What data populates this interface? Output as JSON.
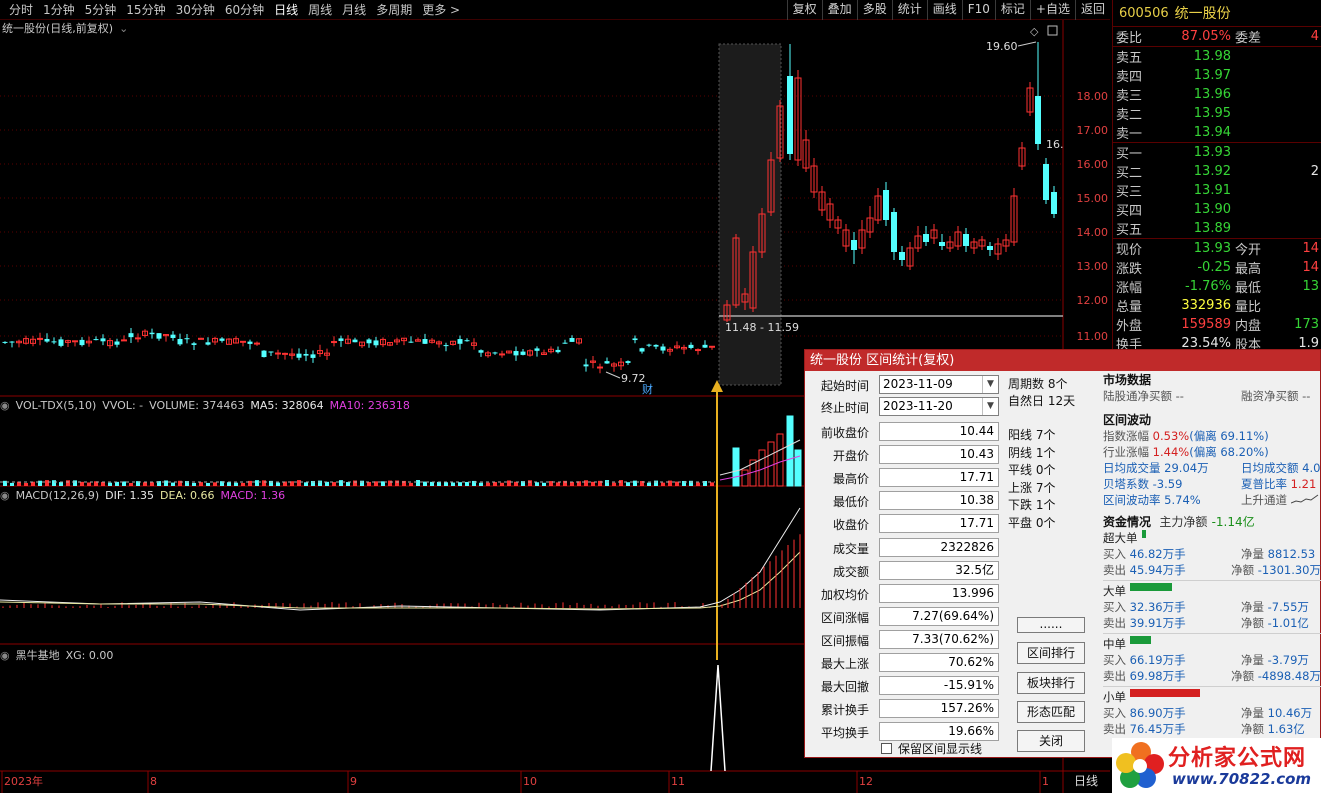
{
  "topbar": {
    "periods": [
      "分时",
      "1分钟",
      "5分钟",
      "15分钟",
      "30分钟",
      "60分钟",
      "日线",
      "周线",
      "月线",
      "多周期",
      "更多 >"
    ],
    "active_period": "日线",
    "tools": [
      "复权",
      "叠加",
      "多股",
      "统计",
      "画线",
      "F10",
      "标记",
      "+自选",
      "返回"
    ]
  },
  "main_chart": {
    "title": "统一股份(日线,前复权)",
    "price_axis": [
      "18.00",
      "17.00",
      "16.00",
      "15.00",
      "14.00",
      "13.00",
      "12.00",
      "11.00"
    ],
    "high_label": "19.60",
    "low_label": "9.72",
    "right_label": "16.",
    "range_label": "11.48 - 11.59",
    "marker": "财"
  },
  "vol_panel": {
    "name": "VOL-TDX(5,10)",
    "vvol": "VVOL: -",
    "volume": "VOLUME: 374463",
    "ma5": "MA5: 328064",
    "ma10": "MA10: 236318"
  },
  "macd_panel": {
    "name": "MACD(12,26,9)",
    "dif": "DIF: 1.35",
    "dea": "DEA: 0.66",
    "macd": "MACD: 1.36"
  },
  "xg_panel": {
    "name": "黑牛基地",
    "xg": "XG: 0.00"
  },
  "time_axis": [
    "2023年",
    "8",
    "9",
    "10",
    "11",
    "12",
    "1"
  ],
  "bottom_tab": "日线",
  "quote": {
    "code": "600506",
    "name": "统一股份",
    "weibi_label": "委比",
    "weibi": "87.05%",
    "weicha_label": "委差",
    "weicha": "4",
    "asks": [
      {
        "label": "卖五",
        "price": "13.98",
        "vol": ""
      },
      {
        "label": "卖四",
        "price": "13.97",
        "vol": ""
      },
      {
        "label": "卖三",
        "price": "13.96",
        "vol": ""
      },
      {
        "label": "卖二",
        "price": "13.95",
        "vol": ""
      },
      {
        "label": "卖一",
        "price": "13.94",
        "vol": ""
      }
    ],
    "bids": [
      {
        "label": "买一",
        "price": "13.93",
        "vol": ""
      },
      {
        "label": "买二",
        "price": "13.92",
        "vol": "2"
      },
      {
        "label": "买三",
        "price": "13.91",
        "vol": ""
      },
      {
        "label": "买四",
        "price": "13.90",
        "vol": ""
      },
      {
        "label": "买五",
        "price": "13.89",
        "vol": ""
      }
    ],
    "stats": [
      {
        "l1": "现价",
        "v1": "13.93",
        "c1": "green",
        "l2": "今开",
        "v2": "14",
        "c2": "red"
      },
      {
        "l1": "涨跌",
        "v1": "-0.25",
        "c1": "green",
        "l2": "最高",
        "v2": "14",
        "c2": "red"
      },
      {
        "l1": "涨幅",
        "v1": "-1.76%",
        "c1": "green",
        "l2": "最低",
        "v2": "13",
        "c2": "green"
      },
      {
        "l1": "总量",
        "v1": "332936",
        "c1": "yellow",
        "l2": "量比",
        "v2": "",
        "c2": "yellow"
      },
      {
        "l1": "外盘",
        "v1": "159589",
        "c1": "red",
        "l2": "内盘",
        "v2": "173",
        "c2": "green"
      },
      {
        "l1": "换手",
        "v1": "23.54%",
        "c1": "white",
        "l2": "股本",
        "v2": "1.9",
        "c2": "white"
      }
    ]
  },
  "dialog": {
    "title": "统一股份 区间统计(复权)",
    "start_label": "起始时间",
    "start": "2023-11-09",
    "end_label": "终止时间",
    "end": "2023-11-20",
    "fields": [
      {
        "label": "前收盘价",
        "value": "10.44"
      },
      {
        "label": "开盘价",
        "value": "10.43"
      },
      {
        "label": "最高价",
        "value": "17.71"
      },
      {
        "label": "最低价",
        "value": "10.38"
      },
      {
        "label": "收盘价",
        "value": "17.71"
      },
      {
        "label": "成交量",
        "value": "2322826"
      },
      {
        "label": "成交额",
        "value": "32.5亿"
      },
      {
        "label": "加权均价",
        "value": "13.996"
      },
      {
        "label": "区间涨幅",
        "value": "7.27(69.64%)"
      },
      {
        "label": "区间振幅",
        "value": "7.33(70.62%)"
      },
      {
        "label": "最大上涨",
        "value": "70.62%"
      },
      {
        "label": "最大回撤",
        "value": "-15.91%"
      },
      {
        "label": "累计换手",
        "value": "157.26%"
      },
      {
        "label": "平均换手",
        "value": "19.66%"
      }
    ],
    "period_count": "周期数 8个",
    "natural_days": "自然日 12天",
    "counts": [
      "阳线 7个",
      "阴线 1个",
      "平线 0个",
      "上涨 7个",
      "下跌 1个",
      "平盘 0个"
    ],
    "buttons": [
      "......",
      "区间排行",
      "板块排行",
      "形态匹配",
      "关闭"
    ],
    "checkbox_label": "保留区间显示线",
    "market_title": "市场数据",
    "hk_flow": "陆股通净买额 --",
    "margin_buy": "融资净买额 --",
    "vol_title": "区间波动",
    "index_chg_label": "指数涨幅",
    "index_chg": "0.53%",
    "index_dev": "(偏离 69.11%)",
    "ind_chg_label": "行业涨幅",
    "ind_chg": "1.44%",
    "ind_dev": "(偏离 68.20%)",
    "avg_vol": "日均成交量 29.04万",
    "avg_amt": "日均成交额 4.0",
    "beta": "贝塔系数 -3.59",
    "sharpe_label": "夏普比率",
    "sharpe": "1.21",
    "volatility": "区间波动率 5.74%",
    "channel": "上升通道",
    "fund_title": "资金情况",
    "main_net_label": "主力净额",
    "main_net": "-1.14亿",
    "groups": [
      {
        "name": "超大单",
        "buy": "46.82万手",
        "sell": "45.94万手",
        "net_buy": "8812.53",
        "net_sell": "-1301.30万",
        "bar_color": "#1a9a3a",
        "bar_frac": 0.05
      },
      {
        "name": "大单",
        "buy": "32.36万手",
        "sell": "39.91万手",
        "net_buy": "-7.55万",
        "net_sell": "-1.01亿",
        "bar_color": "#1a9a3a",
        "bar_frac": 0.6
      },
      {
        "name": "中单",
        "buy": "66.19万手",
        "sell": "69.98万手",
        "net_buy": "-3.79万",
        "net_sell": "-4898.48万",
        "bar_color": "#1a9a3a",
        "bar_frac": 0.3
      },
      {
        "name": "小单",
        "buy": "86.90万手",
        "sell": "76.45万手",
        "net_buy": "10.46万",
        "net_sell": "1.63亿",
        "bar_color": "#d42020",
        "bar_frac": 1.0
      }
    ],
    "labels": {
      "buy": "买入",
      "sell": "卖出",
      "net": "净量",
      "amt": "净额"
    }
  },
  "watermark": {
    "text1": "分析家公式网",
    "text2": "www.70822.com"
  },
  "colors": {
    "up": "#ff3232",
    "down": "#54ffff",
    "bg": "#000000",
    "grid": "#5a0000"
  }
}
